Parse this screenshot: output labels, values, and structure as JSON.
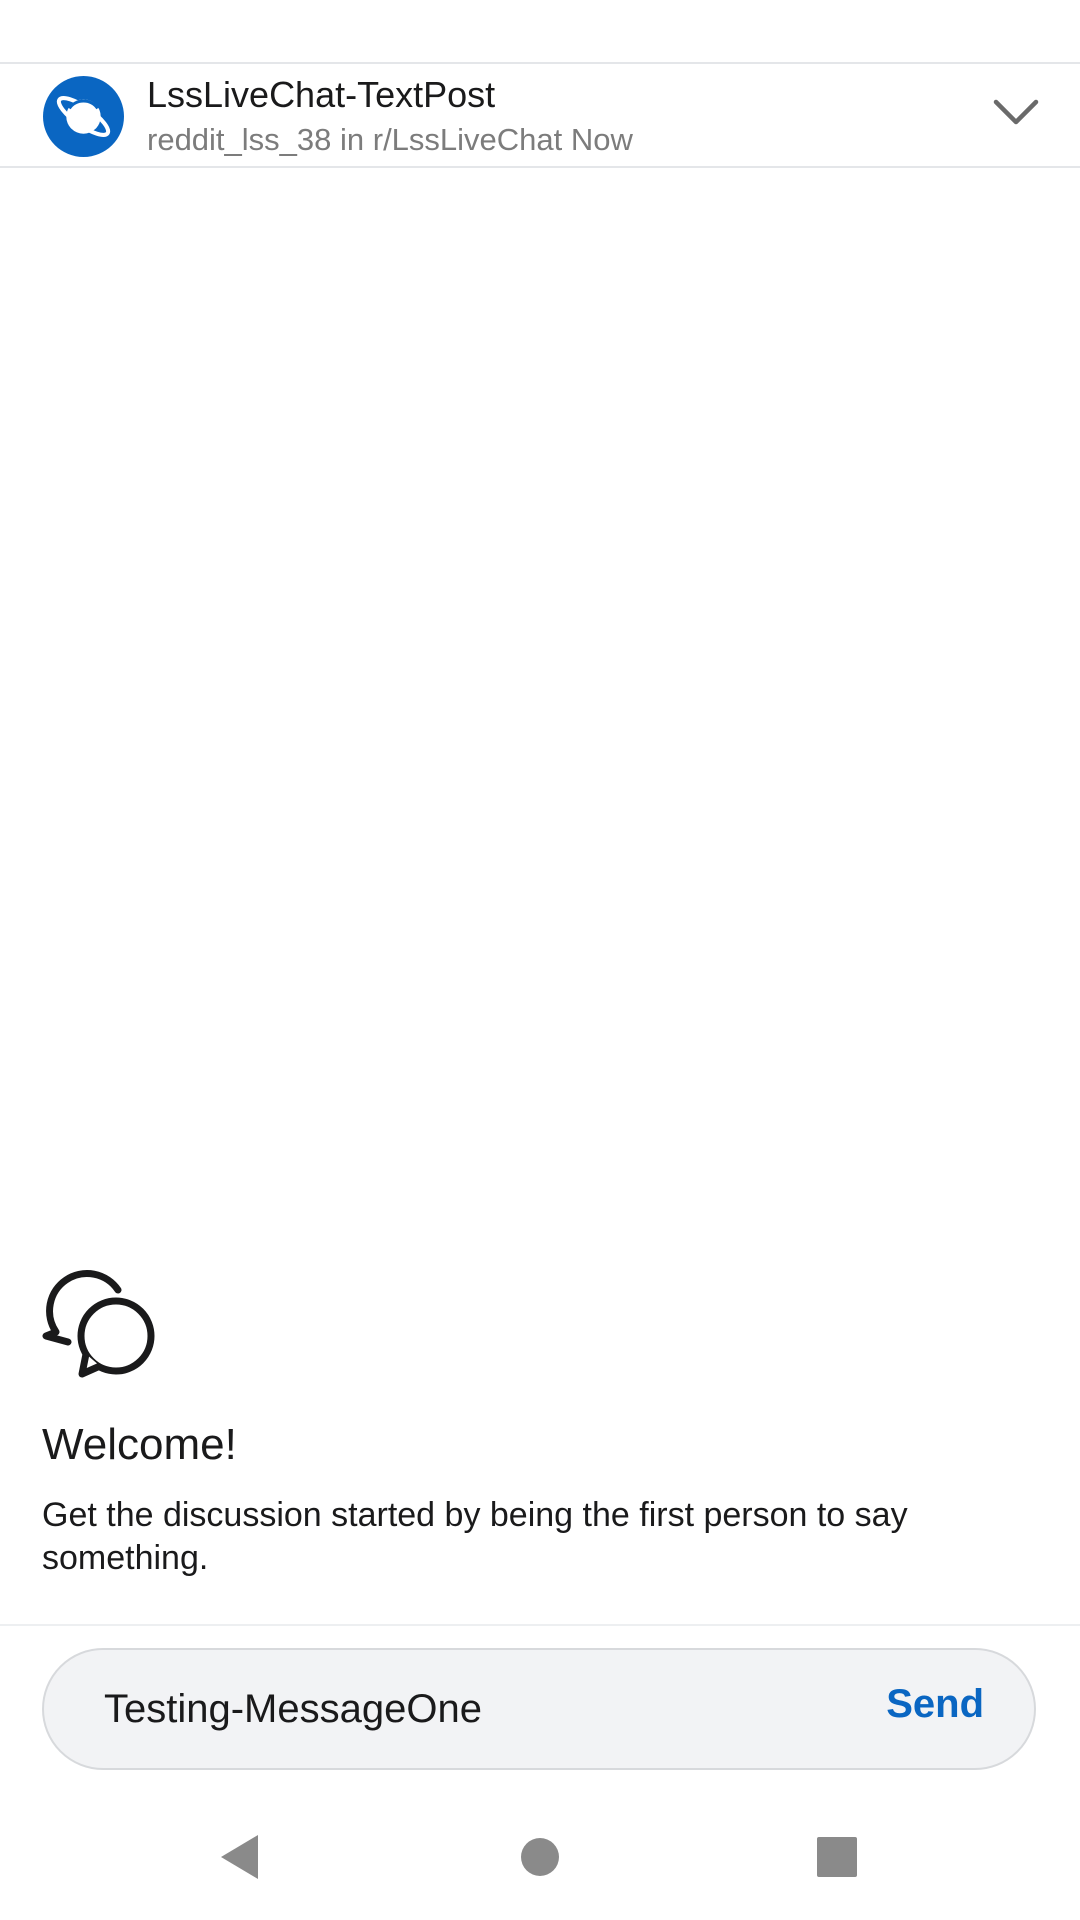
{
  "header": {
    "title": "LssLiveChat-TextPost",
    "subtitle": "reddit_lss_38 in r/LssLiveChat Now",
    "avatar_icon": "planet-icon",
    "collapse_icon": "chevron-down-icon"
  },
  "empty_state": {
    "icon": "chat-bubbles-icon",
    "title": "Welcome!",
    "message": "Get the discussion started by being the first person to say something."
  },
  "composer": {
    "value": "Testing-MessageOne",
    "send_label": "Send"
  },
  "nav": {
    "back_icon": "back-icon",
    "home_icon": "home-icon",
    "recents_icon": "recents-icon"
  },
  "colors": {
    "accent": "#0a66c2",
    "avatar_bg": "#0a66c2",
    "text_primary": "#1a1a1b",
    "text_secondary": "#7c7c7c",
    "input_bg": "#f2f3f5",
    "nav_icon": "#8a8a8a"
  }
}
